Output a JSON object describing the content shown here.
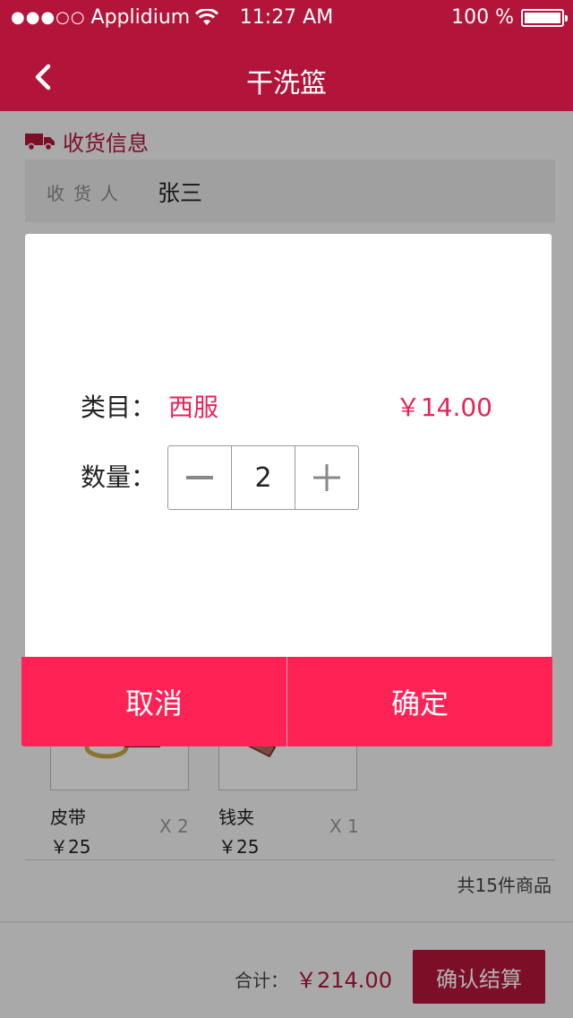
{
  "status_bar": {
    "carrier": "Applidium",
    "time": "11:27  AM",
    "battery": "100 %"
  },
  "nav": {
    "title": "干洗篮"
  },
  "shipping": {
    "section_title": "收货信息",
    "receiver_label": "收货人",
    "receiver_name": "张三"
  },
  "items": [
    {
      "name": "皮带",
      "price": "￥25",
      "qty": "X 2"
    },
    {
      "name": "钱夹",
      "price": "￥25",
      "qty": "X 1"
    }
  ],
  "summary": {
    "count_text": "共15件商品",
    "total_label": "合计：",
    "total_value": "￥214.00",
    "checkout_label": "确认结算"
  },
  "dialog": {
    "category_label": "类目：",
    "category_value": "西服",
    "price": "￥14.00",
    "quantity_label": "数量：",
    "quantity_value": "2",
    "minus": "−",
    "plus": "+",
    "cancel_label": "取消",
    "confirm_label": "确定"
  },
  "colors": {
    "brand": "#b3153a",
    "accent": "#ff2255",
    "price_text": "#e8245a"
  }
}
